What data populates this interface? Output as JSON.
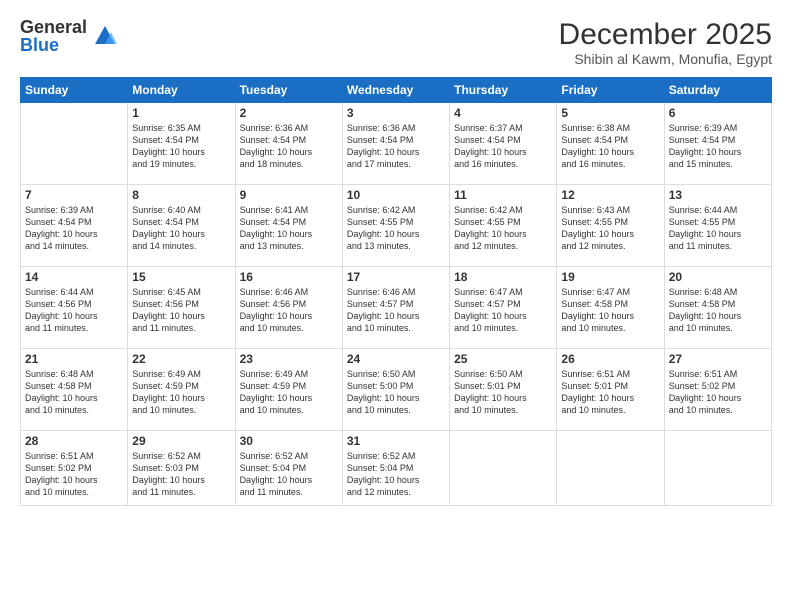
{
  "logo": {
    "general": "General",
    "blue": "Blue"
  },
  "title": "December 2025",
  "subtitle": "Shibin al Kawm, Monufia, Egypt",
  "days_of_week": [
    "Sunday",
    "Monday",
    "Tuesday",
    "Wednesday",
    "Thursday",
    "Friday",
    "Saturday"
  ],
  "weeks": [
    [
      {
        "day": "",
        "info": ""
      },
      {
        "day": "1",
        "info": "Sunrise: 6:35 AM\nSunset: 4:54 PM\nDaylight: 10 hours\nand 19 minutes."
      },
      {
        "day": "2",
        "info": "Sunrise: 6:36 AM\nSunset: 4:54 PM\nDaylight: 10 hours\nand 18 minutes."
      },
      {
        "day": "3",
        "info": "Sunrise: 6:36 AM\nSunset: 4:54 PM\nDaylight: 10 hours\nand 17 minutes."
      },
      {
        "day": "4",
        "info": "Sunrise: 6:37 AM\nSunset: 4:54 PM\nDaylight: 10 hours\nand 16 minutes."
      },
      {
        "day": "5",
        "info": "Sunrise: 6:38 AM\nSunset: 4:54 PM\nDaylight: 10 hours\nand 16 minutes."
      },
      {
        "day": "6",
        "info": "Sunrise: 6:39 AM\nSunset: 4:54 PM\nDaylight: 10 hours\nand 15 minutes."
      }
    ],
    [
      {
        "day": "7",
        "info": "Sunrise: 6:39 AM\nSunset: 4:54 PM\nDaylight: 10 hours\nand 14 minutes."
      },
      {
        "day": "8",
        "info": "Sunrise: 6:40 AM\nSunset: 4:54 PM\nDaylight: 10 hours\nand 14 minutes."
      },
      {
        "day": "9",
        "info": "Sunrise: 6:41 AM\nSunset: 4:54 PM\nDaylight: 10 hours\nand 13 minutes."
      },
      {
        "day": "10",
        "info": "Sunrise: 6:42 AM\nSunset: 4:55 PM\nDaylight: 10 hours\nand 13 minutes."
      },
      {
        "day": "11",
        "info": "Sunrise: 6:42 AM\nSunset: 4:55 PM\nDaylight: 10 hours\nand 12 minutes."
      },
      {
        "day": "12",
        "info": "Sunrise: 6:43 AM\nSunset: 4:55 PM\nDaylight: 10 hours\nand 12 minutes."
      },
      {
        "day": "13",
        "info": "Sunrise: 6:44 AM\nSunset: 4:55 PM\nDaylight: 10 hours\nand 11 minutes."
      }
    ],
    [
      {
        "day": "14",
        "info": "Sunrise: 6:44 AM\nSunset: 4:56 PM\nDaylight: 10 hours\nand 11 minutes."
      },
      {
        "day": "15",
        "info": "Sunrise: 6:45 AM\nSunset: 4:56 PM\nDaylight: 10 hours\nand 11 minutes."
      },
      {
        "day": "16",
        "info": "Sunrise: 6:46 AM\nSunset: 4:56 PM\nDaylight: 10 hours\nand 10 minutes."
      },
      {
        "day": "17",
        "info": "Sunrise: 6:46 AM\nSunset: 4:57 PM\nDaylight: 10 hours\nand 10 minutes."
      },
      {
        "day": "18",
        "info": "Sunrise: 6:47 AM\nSunset: 4:57 PM\nDaylight: 10 hours\nand 10 minutes."
      },
      {
        "day": "19",
        "info": "Sunrise: 6:47 AM\nSunset: 4:58 PM\nDaylight: 10 hours\nand 10 minutes."
      },
      {
        "day": "20",
        "info": "Sunrise: 6:48 AM\nSunset: 4:58 PM\nDaylight: 10 hours\nand 10 minutes."
      }
    ],
    [
      {
        "day": "21",
        "info": "Sunrise: 6:48 AM\nSunset: 4:58 PM\nDaylight: 10 hours\nand 10 minutes."
      },
      {
        "day": "22",
        "info": "Sunrise: 6:49 AM\nSunset: 4:59 PM\nDaylight: 10 hours\nand 10 minutes."
      },
      {
        "day": "23",
        "info": "Sunrise: 6:49 AM\nSunset: 4:59 PM\nDaylight: 10 hours\nand 10 minutes."
      },
      {
        "day": "24",
        "info": "Sunrise: 6:50 AM\nSunset: 5:00 PM\nDaylight: 10 hours\nand 10 minutes."
      },
      {
        "day": "25",
        "info": "Sunrise: 6:50 AM\nSunset: 5:01 PM\nDaylight: 10 hours\nand 10 minutes."
      },
      {
        "day": "26",
        "info": "Sunrise: 6:51 AM\nSunset: 5:01 PM\nDaylight: 10 hours\nand 10 minutes."
      },
      {
        "day": "27",
        "info": "Sunrise: 6:51 AM\nSunset: 5:02 PM\nDaylight: 10 hours\nand 10 minutes."
      }
    ],
    [
      {
        "day": "28",
        "info": "Sunrise: 6:51 AM\nSunset: 5:02 PM\nDaylight: 10 hours\nand 10 minutes."
      },
      {
        "day": "29",
        "info": "Sunrise: 6:52 AM\nSunset: 5:03 PM\nDaylight: 10 hours\nand 11 minutes."
      },
      {
        "day": "30",
        "info": "Sunrise: 6:52 AM\nSunset: 5:04 PM\nDaylight: 10 hours\nand 11 minutes."
      },
      {
        "day": "31",
        "info": "Sunrise: 6:52 AM\nSunset: 5:04 PM\nDaylight: 10 hours\nand 12 minutes."
      },
      {
        "day": "",
        "info": ""
      },
      {
        "day": "",
        "info": ""
      },
      {
        "day": "",
        "info": ""
      }
    ]
  ]
}
